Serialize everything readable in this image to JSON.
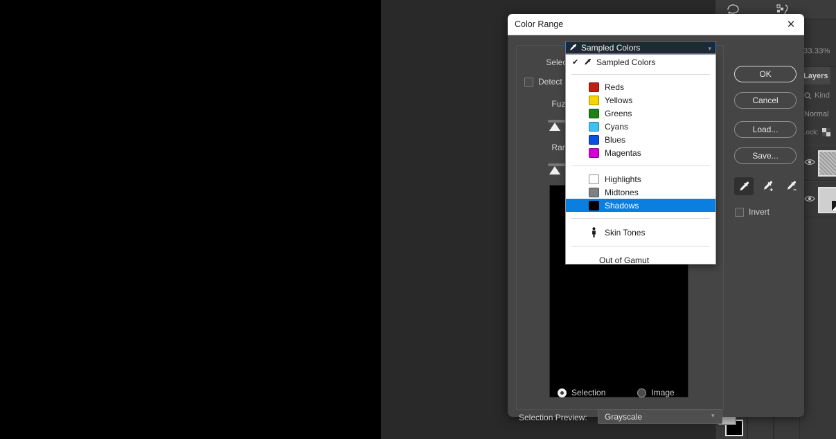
{
  "app": {
    "zoom_level": "33.33%",
    "toolbar_icons": [
      "lasso-icon",
      "history-brush-icon"
    ],
    "color_swatch": {
      "foreground": "#c9c9c9",
      "background": "#000000"
    }
  },
  "layers_panel": {
    "tab_label": "Layers",
    "filter_label": "Kind",
    "blend_mode": "Normal",
    "lock_label": "Lock:",
    "layers": [
      {
        "visible": true,
        "thumb": "noisy"
      },
      {
        "visible": true,
        "thumb": "doc"
      }
    ]
  },
  "dialog": {
    "title": "Color Range",
    "close_label": "✕",
    "labels": {
      "select": "Select:",
      "detect_faces": "Detect F",
      "fuzziness": "Fuzzi",
      "range": "Rang"
    },
    "buttons": [
      {
        "name": "ok",
        "label": "OK"
      },
      {
        "name": "cancel",
        "label": "Cancel"
      },
      {
        "name": "load",
        "label": "Load..."
      },
      {
        "name": "save",
        "label": "Save..."
      }
    ],
    "eyedroppers": [
      {
        "name": "eyedropper",
        "glyph": "",
        "active": true
      },
      {
        "name": "eyedropper-add",
        "glyph": "+",
        "active": false
      },
      {
        "name": "eyedropper-subtract",
        "glyph": "−",
        "active": false
      }
    ],
    "invert": {
      "label": "Invert",
      "checked": false
    },
    "preview_mode": {
      "options": [
        {
          "label": "Selection",
          "selected": true
        },
        {
          "label": "Image",
          "selected": false
        }
      ]
    },
    "selection_preview": {
      "label": "Selection Preview:",
      "value": "Grayscale"
    },
    "combo": {
      "value": "Sampled Colors",
      "icon": "eyedropper-icon",
      "items": [
        {
          "label": "Sampled Colors",
          "checked": true,
          "icon": "eyedropper-icon",
          "selected": false,
          "type": "check"
        },
        {
          "type": "divider"
        },
        {
          "label": "Reds",
          "swatch": "#c02010",
          "selected": false,
          "type": "swatch"
        },
        {
          "label": "Yellows",
          "swatch": "#f5d400",
          "selected": false,
          "type": "swatch"
        },
        {
          "label": "Greens",
          "swatch": "#1e7f12",
          "selected": false,
          "type": "swatch"
        },
        {
          "label": "Cyans",
          "swatch": "#3ec2f2",
          "selected": false,
          "type": "swatch"
        },
        {
          "label": "Blues",
          "swatch": "#0a4fe0",
          "selected": false,
          "type": "swatch"
        },
        {
          "label": "Magentas",
          "swatch": "#d400d4",
          "selected": false,
          "type": "swatch"
        },
        {
          "type": "divider"
        },
        {
          "label": "Highlights",
          "swatch": "#ffffff",
          "selected": false,
          "type": "swatch"
        },
        {
          "label": "Midtones",
          "swatch": "#808080",
          "selected": false,
          "type": "swatch"
        },
        {
          "label": "Shadows",
          "swatch": "#000000",
          "selected": true,
          "type": "swatch"
        },
        {
          "type": "divider"
        },
        {
          "label": "Skin Tones",
          "icon": "person-icon",
          "selected": false,
          "type": "icon"
        },
        {
          "type": "divider"
        },
        {
          "label": "Out of Gamut",
          "selected": false,
          "type": "plain"
        }
      ]
    }
  }
}
